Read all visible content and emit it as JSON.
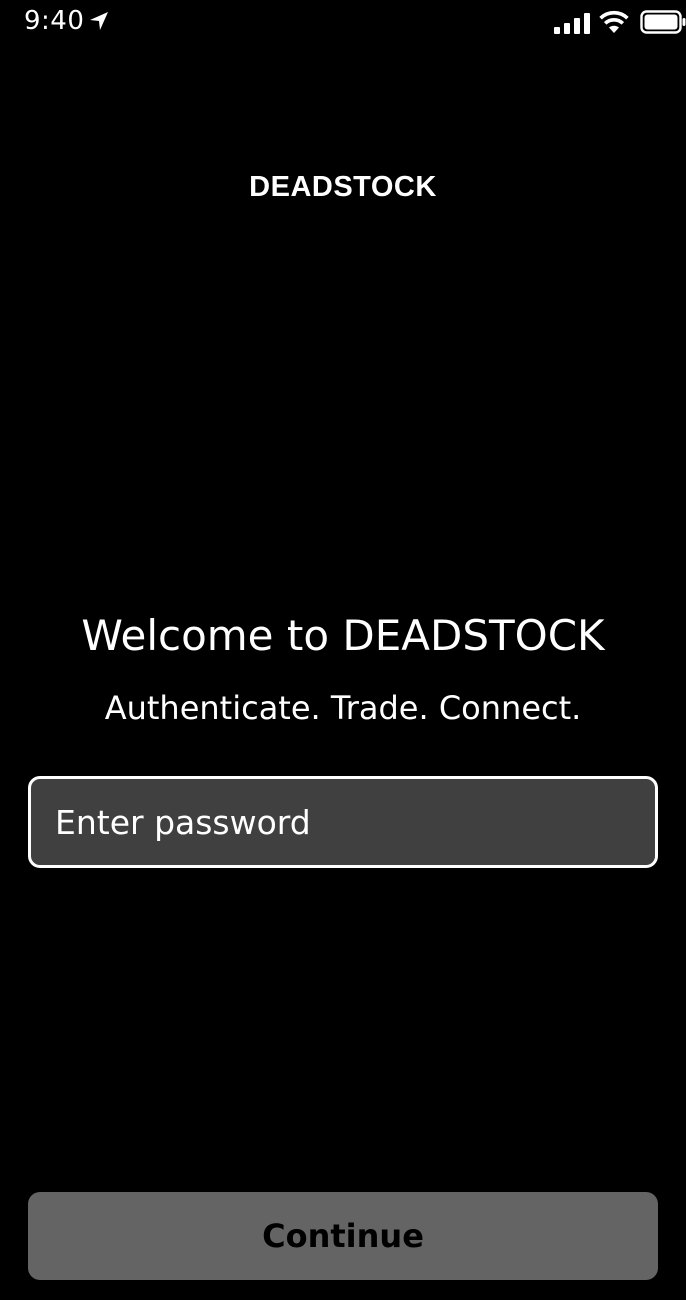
{
  "status_bar": {
    "time": "9:40",
    "icons": [
      "location-arrow-icon",
      "cellular-signal-icon",
      "wifi-icon",
      "battery-icon"
    ]
  },
  "header": {
    "brand": "DEADSTOCK"
  },
  "welcome": {
    "title": "Welcome to DEADSTOCK",
    "tagline": "Authenticate. Trade. Connect."
  },
  "password": {
    "value": "",
    "placeholder": "Enter password"
  },
  "continue_button": {
    "label": "Continue"
  },
  "colors": {
    "background": "#000000",
    "text": "#ffffff",
    "input_background": "#404040",
    "input_border": "#ffffff",
    "button_background": "#646464",
    "button_text": "#000000"
  }
}
